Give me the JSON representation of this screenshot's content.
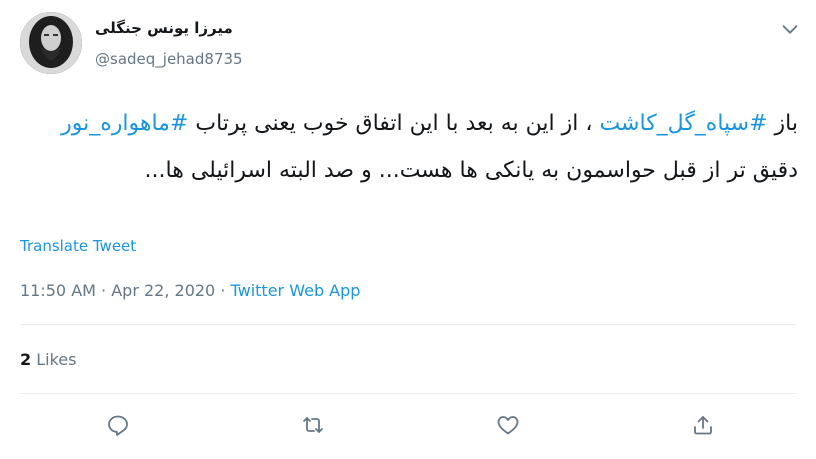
{
  "user": {
    "display_name": "میرزا یونس جنگلی",
    "handle": "@sadeq_jehad8735"
  },
  "tweet": {
    "parts": [
      {
        "text": "باز ",
        "type": "text"
      },
      {
        "text": "#سپاه_گل_کاشت",
        "type": "hashtag"
      },
      {
        "text": " ، از این به بعد با این اتفاق خوب یعنی پرتاب ",
        "type": "text"
      },
      {
        "text": "#ماهواره_نور",
        "type": "hashtag"
      },
      {
        "text": " دقیق تر از قبل حواسمون به یانکی ها هست... و صد البته اسرائیلی ها...",
        "type": "text"
      }
    ]
  },
  "translate_label": "Translate Tweet",
  "meta": {
    "time": "11:50 AM",
    "separator1": " · ",
    "date": "Apr 22, 2020",
    "separator2": " · ",
    "source": "Twitter Web App"
  },
  "likes": {
    "count": "2",
    "label": "Likes"
  },
  "icons": {
    "reply": "reply-icon",
    "retweet": "retweet-icon",
    "like": "heart-icon",
    "share": "share-icon",
    "more": "chevron-down-icon"
  },
  "colors": {
    "link": "#1b95e0",
    "muted": "#657786",
    "text": "#14171a",
    "divider": "#e6ecf0"
  }
}
